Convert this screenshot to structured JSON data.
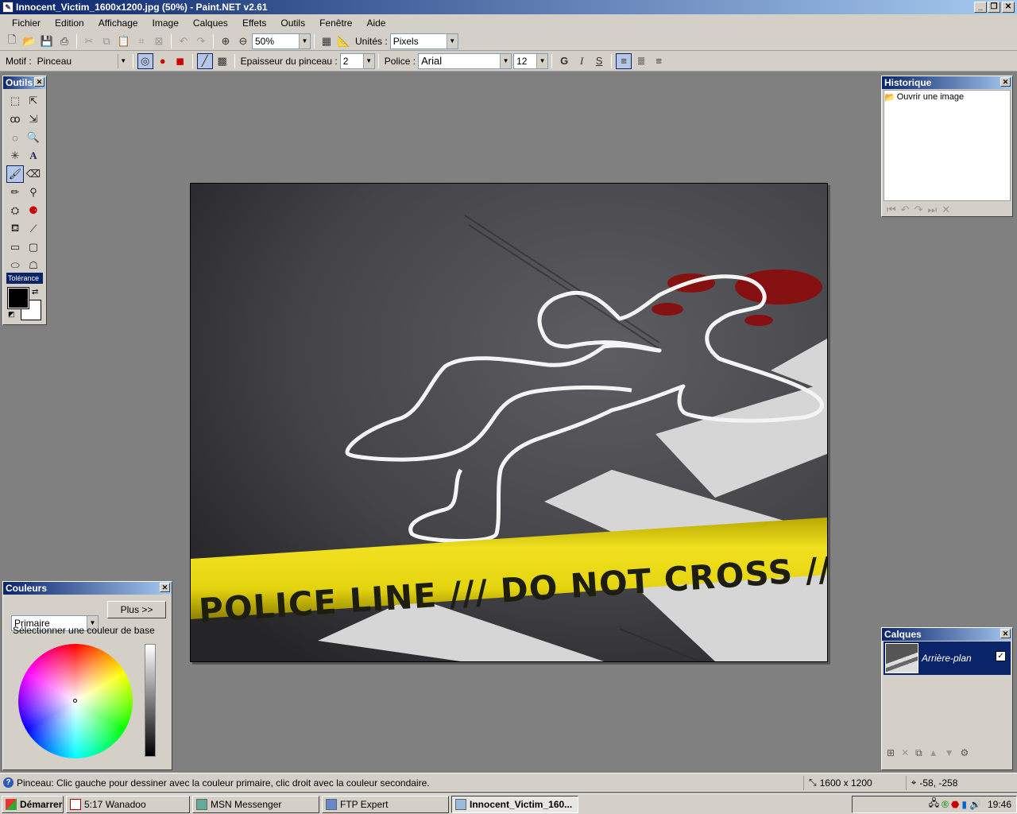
{
  "window": {
    "title": "Innocent_Victim_1600x1200.jpg (50%) - Paint.NET v2.61"
  },
  "menu": [
    "Fichier",
    "Edition",
    "Affichage",
    "Image",
    "Calques",
    "Effets",
    "Outils",
    "Fenêtre",
    "Aide"
  ],
  "toolbar1": {
    "zoom": "50%",
    "units_label": "Unités :",
    "units_value": "Pixels"
  },
  "toolbar2": {
    "motif_label": "Motif :",
    "motif_value": "Pinceau",
    "brush_label": "Epaisseur du pinceau :",
    "brush_value": "2",
    "font_label": "Police :",
    "font_value": "Arial",
    "font_size": "12",
    "bold": "G",
    "italic": "I",
    "underline": "S"
  },
  "tools": {
    "title": "Outils",
    "tolerance": "Tolérance"
  },
  "image": {
    "tape_text": "POLICE LINE /// DO NOT CROSS /// P"
  },
  "history": {
    "title": "Historique",
    "items": [
      "Ouvrir une image"
    ]
  },
  "layers": {
    "title": "Calques",
    "items": [
      "Arrière-plan"
    ]
  },
  "colors": {
    "title": "Couleurs",
    "select_value": "Primaire",
    "more_button": "Plus >>",
    "hint": "Sélectionner une couleur de base",
    "primary": "#000000",
    "secondary": "#ffffff"
  },
  "status": {
    "message": "Pinceau: Clic gauche pour dessiner avec la couleur primaire, clic droit avec la couleur secondaire.",
    "size": "1600 x 1200",
    "coords": "-58, -258"
  },
  "taskbar": {
    "start": "Démarrer",
    "tasks": [
      "5:17 Wanadoo",
      "MSN Messenger",
      "FTP Expert",
      "Innocent_Victim_160..."
    ],
    "clock": "19:46"
  }
}
